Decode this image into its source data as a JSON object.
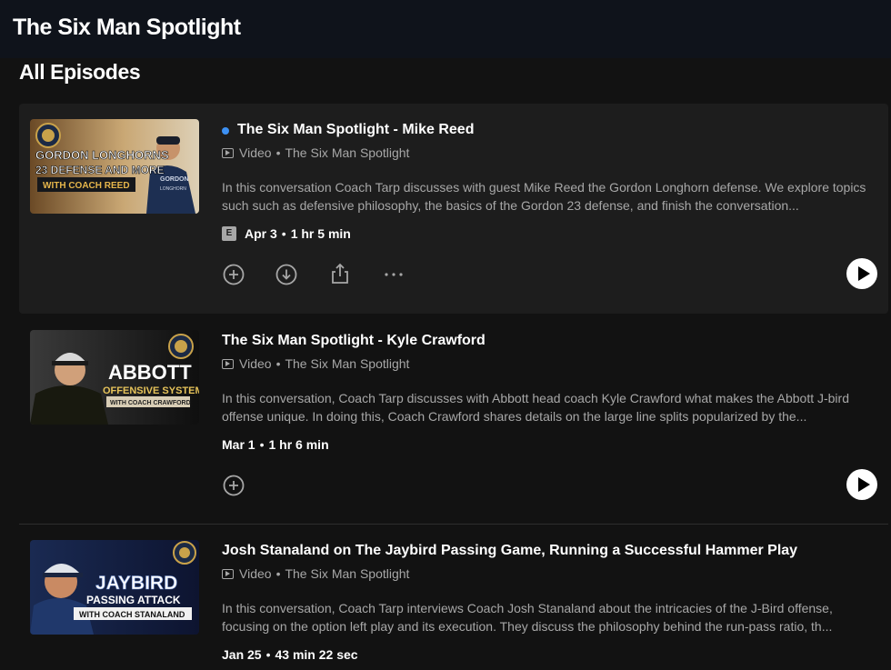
{
  "header": {
    "show_title": "The Six Man Spotlight"
  },
  "section_title": "All Episodes",
  "colors": {
    "new_dot": "#3d91f4",
    "accent": "#ffffff",
    "muted": "#a7a7a7"
  },
  "episodes": [
    {
      "title": "The Six Man Spotlight - Mike Reed",
      "is_new": true,
      "type": "Video",
      "show": "The Six Man Spotlight",
      "description": "In this conversation Coach Tarp discusses with guest Mike Reed the Gordon Longhorn defense. We explore topics such such as defensive philosophy, the basics of the Gordon 23 defense, and finish the conversation...",
      "explicit_badge": "E",
      "date": "Apr 3",
      "duration": "1 hr 5 min",
      "thumb": {
        "line1": "GORDON LONGHORNS",
        "line2": "23 DEFENSE AND MORE",
        "line3": "WITH COACH REED",
        "shirt": "GORDON",
        "shirt2": "LONGHORN"
      }
    },
    {
      "title": "The Six Man Spotlight - Kyle Crawford",
      "is_new": false,
      "type": "Video",
      "show": "The Six Man Spotlight",
      "description": "In this conversation, Coach Tarp discusses with Abbott head coach Kyle Crawford what makes the Abbott J-bird offense unique. In doing this, Coach Crawford shares details on the large line splits popularized by the...",
      "date": "Mar 1",
      "duration": "1 hr 6 min",
      "thumb": {
        "line1": "ABBOTT",
        "line2": "OFFENSIVE SYSTEM",
        "line3": "WITH COACH CRAWFORD"
      }
    },
    {
      "title": "Josh Stanaland on The Jaybird Passing Game, Running a Successful Hammer Play",
      "is_new": false,
      "type": "Video",
      "show": "The Six Man Spotlight",
      "description": "In this conversation, Coach Tarp interviews Coach Josh Stanaland about the intricacies of the J-Bird offense, focusing on the option left play and its execution. They discuss the philosophy behind the run-pass ratio, th...",
      "date": "Jan 25",
      "duration": "43 min 22 sec",
      "thumb": {
        "line1": "JAYBIRD",
        "line2": "PASSING ATTACK",
        "line3": "WITH COACH STANALAND"
      }
    }
  ]
}
